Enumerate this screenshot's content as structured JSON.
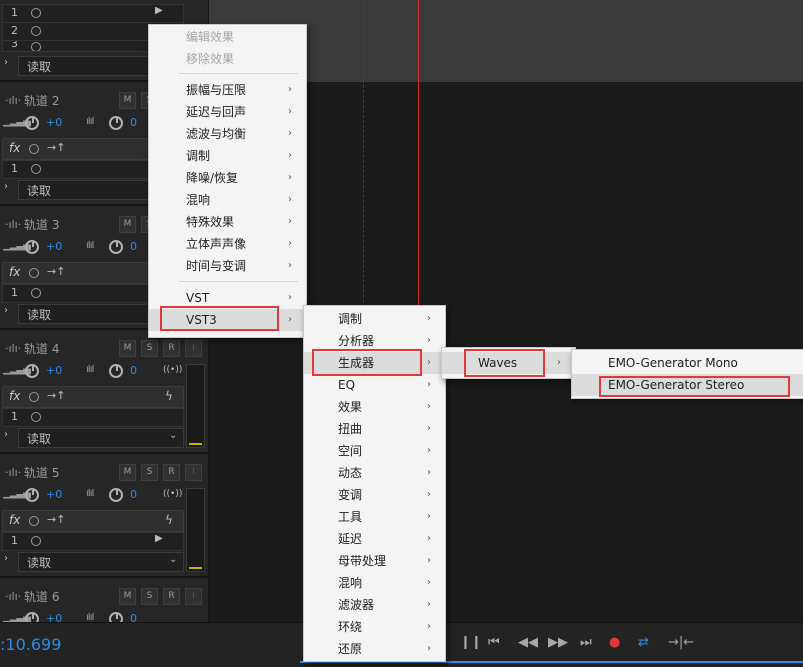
{
  "tracks": [
    {
      "name": "轨道 2",
      "vol": "+0",
      "pan": "0",
      "slot": "1",
      "mode": "读取"
    },
    {
      "name": "轨道 3",
      "vol": "+0",
      "pan": "0",
      "slot": "1",
      "mode": "读取"
    },
    {
      "name": "轨道 4",
      "vol": "+0",
      "pan": "0",
      "slot": "1",
      "mode": "读取"
    },
    {
      "name": "轨道 5",
      "vol": "+0",
      "pan": "0",
      "slot": "1",
      "mode": "读取"
    },
    {
      "name": "轨道 6",
      "vol": "+0",
      "pan": "0"
    }
  ],
  "track1": {
    "slot1": "1",
    "slot2": "2",
    "slot3": "3",
    "mode": "读取"
  },
  "buttons": {
    "m": "M",
    "s": "S",
    "r": "R",
    "i": "I"
  },
  "fx_label": "fx",
  "transport": {
    "timecode": ":10.699"
  },
  "menu_main": {
    "items": [
      "编辑效果",
      "移除效果",
      "振幅与压限",
      "延迟与回声",
      "滤波与均衡",
      "调制",
      "降噪/恢复",
      "混响",
      "特殊效果",
      "立体声声像",
      "时间与变调",
      "VST",
      "VST3"
    ]
  },
  "menu_vst3": {
    "items": [
      "调制",
      "分析器",
      "生成器",
      "EQ",
      "效果",
      "扭曲",
      "空间",
      "动态",
      "变调",
      "工具",
      "延迟",
      "母带处理",
      "混响",
      "滤波器",
      "环绕",
      "还原"
    ]
  },
  "menu_gen": {
    "items": [
      "Waves"
    ]
  },
  "menu_waves": {
    "items": [
      "EMO-Generator Mono",
      "EMO-Generator Stereo"
    ]
  },
  "colors": {
    "accent_blue": "#2d8ceb",
    "highlight_red": "#e0393c",
    "playhead_red": "#d0282b",
    "meter_yellow": "#c8b400"
  }
}
